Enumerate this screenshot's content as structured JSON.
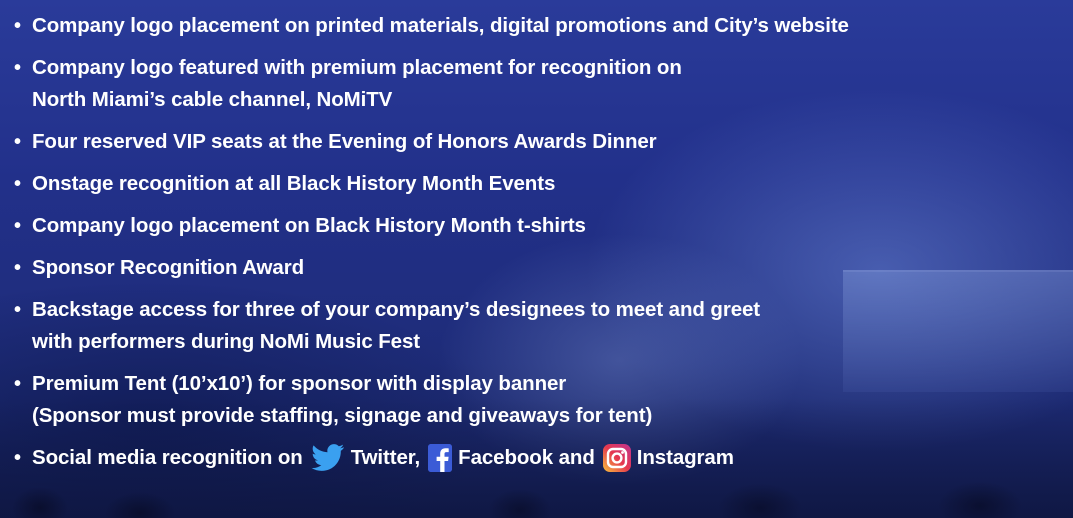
{
  "benefits": [
    {
      "lines": [
        "Company logo placement on printed materials, digital promotions and City’s website"
      ]
    },
    {
      "lines": [
        "Company logo featured with premium placement for recognition on",
        "North Miami’s cable channel, NoMiTV"
      ]
    },
    {
      "lines": [
        "Four reserved VIP seats at the Evening of Honors Awards Dinner"
      ]
    },
    {
      "lines": [
        "Onstage recognition at all Black History Month Events"
      ]
    },
    {
      "lines": [
        "Company logo placement on Black History Month t-shirts"
      ]
    },
    {
      "lines": [
        "Sponsor Recognition Award"
      ]
    },
    {
      "lines": [
        "Backstage access for three of your company’s designees to meet and greet",
        "with performers during NoMi Music Fest"
      ]
    },
    {
      "lines": [
        "Premium Tent (10’x10’) for sponsor with display banner",
        "(Sponsor must provide staffing, signage and giveaways for tent)"
      ]
    }
  ],
  "social": {
    "prefix": "Social media recognition on",
    "twitter": "Twitter,",
    "facebook": "Facebook and",
    "instagram": "Instagram"
  },
  "bullet": "•",
  "colors": {
    "text": "#ffffff",
    "background": "#22308a",
    "twitter_icon": "#3aa0f0",
    "facebook_icon": "#3b5bd6",
    "instagram_icon_start": "#f9c23c",
    "instagram_icon_end": "#c1358f"
  },
  "icons": [
    "twitter-icon",
    "facebook-icon",
    "instagram-icon"
  ]
}
